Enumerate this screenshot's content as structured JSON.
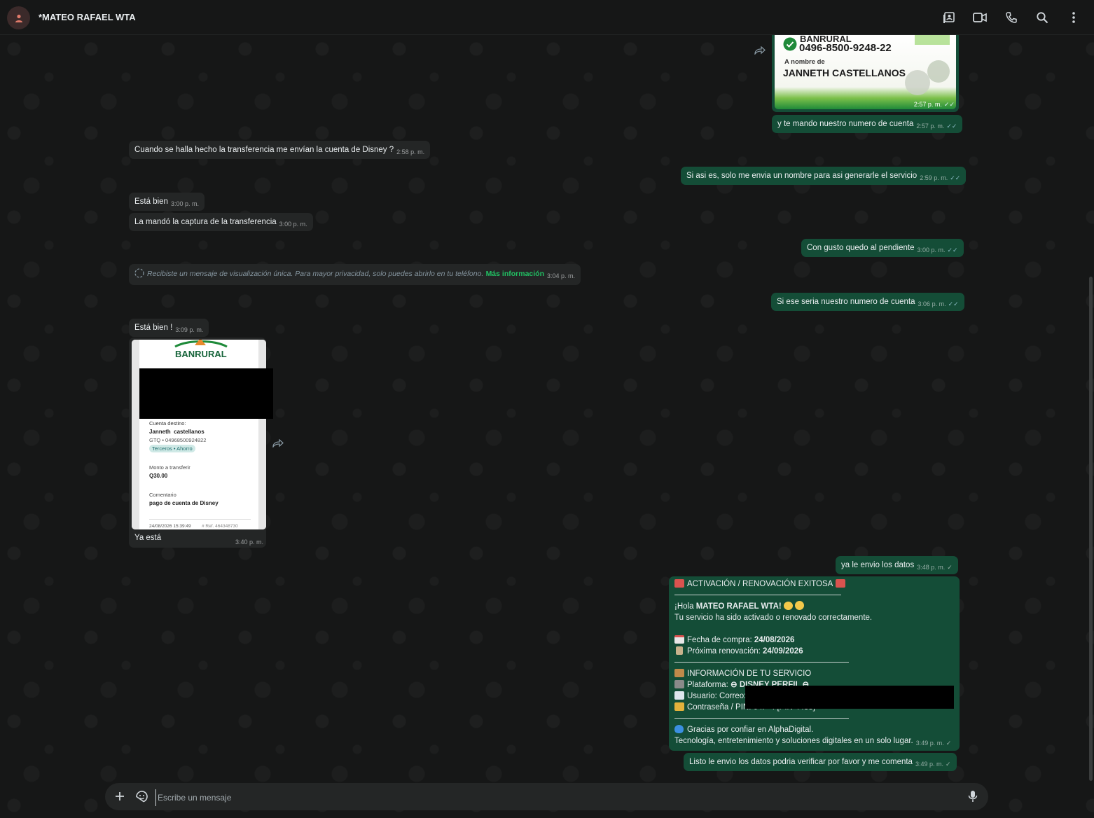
{
  "header": {
    "contact_name": "*MATEO RAFAEL WTA",
    "icons": [
      "contact-card-icon",
      "video-call-icon",
      "phone-icon",
      "search-icon",
      "more-options-icon"
    ]
  },
  "colors": {
    "outgoing_bubble": "#144d37",
    "incoming_bubble": "#242626",
    "background": "#161717",
    "accent_green": "#21c063",
    "read_ticks": "#8cbcc6"
  },
  "top_image": {
    "bank": "BANRURAL",
    "account": "0496-8500-9248-22",
    "owner_label": "A nombre de",
    "owner": "JANNETH CASTELLANOS",
    "time": "2:57 p. m."
  },
  "messages": [
    {
      "dir": "out",
      "text": "y te mando nuestro numero de cuenta",
      "time": "2:57 p. m."
    },
    {
      "dir": "in",
      "text": "Cuando se halla hecho la transferencia me envían la cuenta de Disney ?",
      "time": "2:58 p. m."
    },
    {
      "dir": "out",
      "text": "Si asi es, solo me envia un nombre para asi generarle el servicio",
      "time": "2:59 p. m."
    },
    {
      "dir": "in",
      "text": "Está bien",
      "time": "3:00 p. m."
    },
    {
      "dir": "in",
      "text": "La mandó la captura de la transferencia",
      "time": "3:00 p. m."
    },
    {
      "dir": "out",
      "text": "Con gusto quedo al pendiente",
      "time": "3:00 p. m."
    },
    {
      "dir": "in",
      "text": "Recibiste un mensaje de visualización única. Para mayor privacidad, solo puedes abrirlo en tu teléfono.",
      "link": "Más información",
      "time": "3:04 p. m."
    },
    {
      "dir": "out",
      "text": "Si ese seria nuestro numero de cuenta",
      "time": "3:06 p. m."
    },
    {
      "dir": "in",
      "text": "Está bien !",
      "time": "3:09 p. m."
    },
    {
      "dir": "in",
      "text": "Ya está",
      "time": "3:40 p. m."
    },
    {
      "dir": "out",
      "text": "ya le envio los datos",
      "time": "3:48 p. m."
    },
    {
      "dir": "out",
      "text": "Listo le envio los datos podria verificar por favor y me comenta",
      "time": "3:49 p. m."
    }
  ],
  "receipt": {
    "bank": "BANRURAL",
    "dest_label": "Cuenta destino:",
    "dest_name": "Janneth  castellanos",
    "dest_account": "GTQ • 04968500924822",
    "dest_tag": "Terceros • Ahorro",
    "amount_label": "Monto a transferir",
    "amount": "Q30.00",
    "comment_label": "Comentario",
    "comment": "pago de cuenta de Disney",
    "footer": "24/08/2026 15:39:49",
    "footer_ref": "# Ref. 464348730"
  },
  "activation": {
    "title": "ACTIVACIÓN / RENOVACIÓN EXITOSA",
    "greeting_pre": "¡Hola ",
    "greeting_name": "MATEO RAFAEL WTA!",
    "status": "Tu servicio ha sido activado o renovado correctamente.",
    "purchase_label": "Fecha de compra: ",
    "purchase_date": "24/08/2026",
    "renewal_label": "Próxima renovación: ",
    "renewal_date": "24/09/2026",
    "info_title": "INFORMACIÓN DE TU SERVICIO",
    "platform_label": "Plataforma: ",
    "platform_value": "⊖ DISNEY PERFIL ⊖",
    "user_label": "Usuario: Correo:",
    "password_label": "Contraseña / PIN: 04P-4 [PIN 4433]",
    "thanks": "Gracias por confiar en AlphaDigital.",
    "tagline": "Tecnología, entretenimiento y soluciones digitales en un solo lugar.",
    "time": "3:49 p. m."
  },
  "composer": {
    "placeholder": "Escribe un mensaje"
  }
}
